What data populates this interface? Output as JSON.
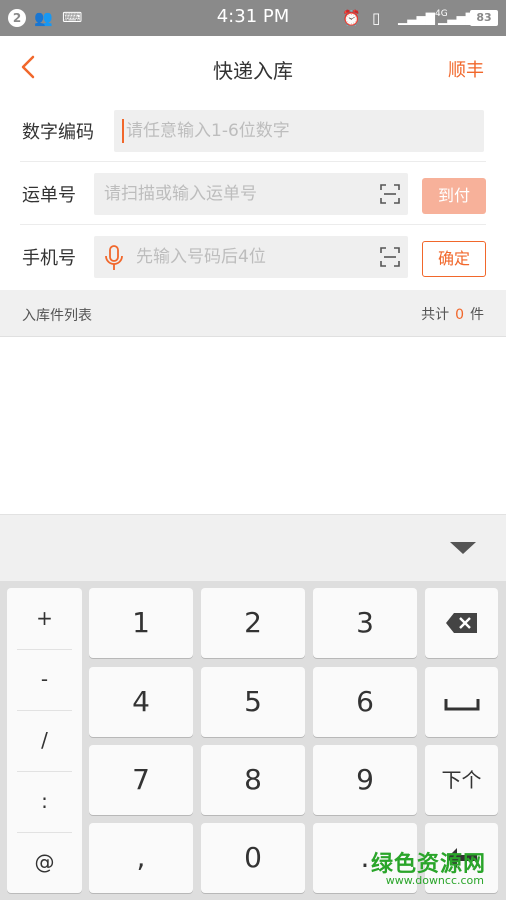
{
  "statusbar": {
    "notif_count": "2",
    "time": "4:31 PM",
    "battery": "83",
    "network": "4G"
  },
  "header": {
    "title": "快递入库",
    "carrier": "顺丰"
  },
  "form": {
    "code_label": "数字编码",
    "code_placeholder": "请任意输入1-6位数字",
    "waybill_label": "运单号",
    "waybill_placeholder": "请扫描或输入运单号",
    "arrive_button": "到付",
    "phone_label": "手机号",
    "phone_placeholder": "先输入号码后4位",
    "confirm_button": "确定"
  },
  "list": {
    "title": "入库件列表",
    "count_prefix": "共计",
    "count": "0",
    "count_suffix": "件"
  },
  "keyboard": {
    "side_keys": [
      "+",
      "-",
      "/",
      ":",
      "@"
    ],
    "digits": [
      "1",
      "2",
      "3",
      "4",
      "5",
      "6",
      "7",
      "8",
      "9"
    ],
    "comma": ",",
    "zero": "0",
    "dot": ".",
    "next": "下个"
  },
  "watermark": {
    "text": "绿色资源网",
    "url": "www.downcc.com"
  },
  "colors": {
    "accent": "#f1672b",
    "statusbar": "#8a8a8a"
  }
}
